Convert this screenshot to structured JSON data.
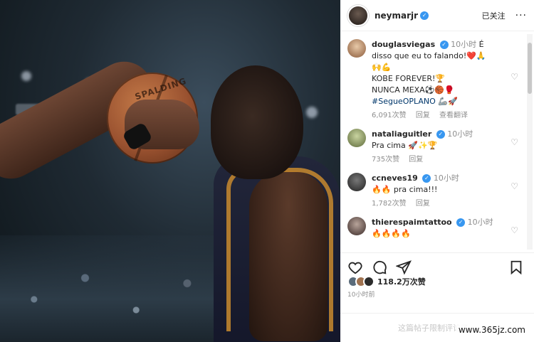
{
  "header": {
    "username": "neymarjr",
    "follow_status": "已关注",
    "more_label": "···"
  },
  "photo": {
    "ball_brand": "SPALDING"
  },
  "comments": [
    {
      "user": "douglasviegas",
      "verified": true,
      "time": "10小时",
      "text_lines": [
        "É disso que eu to falando!❤️🙏",
        "🙌💪",
        "KOBE FOREVER!🏆",
        "NUNCA MEXA⚽🏀🥊"
      ],
      "tag": "#SegueOPLANO",
      "tag_suffix": " 🦾🚀",
      "likes": "6,091次赞",
      "reply": "回复",
      "translate": "查看翻译"
    },
    {
      "user": "nataliaguitler",
      "verified": true,
      "time": "10小时",
      "text": "Pra cima 🚀✨🏆",
      "likes": "735次赞",
      "reply": "回复"
    },
    {
      "user": "ccneves19",
      "verified": true,
      "time": "10小时",
      "text": "🔥🔥 pra cima!!!",
      "likes": "1,782次赞",
      "reply": "回复"
    },
    {
      "user": "thierespaimtattoo",
      "verified": true,
      "time": "10小时",
      "text": "🔥🔥🔥🔥"
    }
  ],
  "post": {
    "likes_total": "118.2万次赞",
    "posted_time": "10小时前",
    "comments_limited": "这篇帖子限制评论了。"
  },
  "watermark": "www.365jz.com",
  "icons": {
    "like": "heart-icon",
    "comment": "comment-icon",
    "share": "share-icon",
    "save": "bookmark-icon"
  }
}
